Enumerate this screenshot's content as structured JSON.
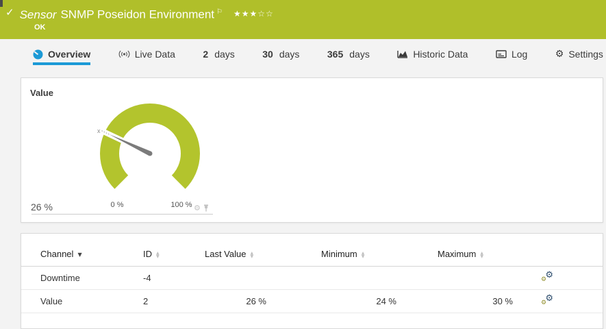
{
  "header": {
    "check_icon": "✓",
    "type_label": "Sensor",
    "name": "SNMP Poseidon Environment",
    "flag_icon": "⚐",
    "stars_filled": "★★★",
    "stars_empty": "☆☆",
    "status": "OK"
  },
  "tabs": [
    {
      "label": "Overview"
    },
    {
      "label": "Live Data"
    },
    {
      "number": "2",
      "label": "days"
    },
    {
      "number": "30",
      "label": "days"
    },
    {
      "number": "365",
      "label": "days"
    },
    {
      "label": "Historic Data"
    },
    {
      "label": "Log"
    },
    {
      "label": "Settings",
      "gear_glyph": "⚙"
    }
  ],
  "gauge": {
    "panel_title": "Value",
    "current": "26 %",
    "scale_start": "0 %",
    "scale_end": "100 %",
    "marker": "x",
    "gear_glyph": "⚙"
  },
  "chart_data": {
    "type": "gauge",
    "title": "Value",
    "value": 26,
    "min": 0,
    "max": 100,
    "unit": "%"
  },
  "table": {
    "headers": {
      "channel": "Channel",
      "id": "ID",
      "last_value": "Last Value",
      "minimum": "Minimum",
      "maximum": "Maximum"
    },
    "gear_glyph": "⚙",
    "rows": [
      {
        "channel": "Downtime",
        "id": "-4",
        "last_value": "",
        "minimum": "",
        "maximum": ""
      },
      {
        "channel": "Value",
        "id": "2",
        "last_value": "26 %",
        "minimum": "24 %",
        "maximum": "30 %"
      }
    ]
  },
  "colors": {
    "brand_green": "#b0bf2a",
    "accent_blue": "#1c9ad6",
    "gauge_green": "#b3c42d"
  }
}
